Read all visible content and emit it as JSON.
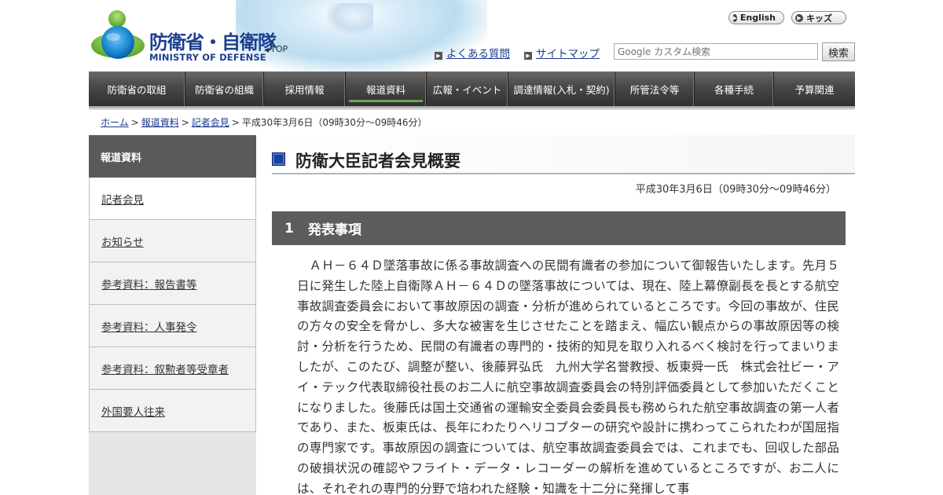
{
  "header": {
    "logo_jp": "防衛省・自衛隊",
    "logo_en": "MINISTRY OF DEFENSE",
    "top_link": "TOP",
    "english_label": "English",
    "kids_label": "キッズ",
    "faq_label": "よくある質問",
    "sitemap_label": "サイトマップ",
    "search_placeholder": "Google カスタム検索",
    "search_button": "検索"
  },
  "nav": {
    "items": [
      {
        "label": "防衛省の取組"
      },
      {
        "label": "防衛省の組織"
      },
      {
        "label": "採用情報"
      },
      {
        "label": "報道資料"
      },
      {
        "label": "広報・イベント"
      },
      {
        "label": "調達情報(入札・契約)"
      },
      {
        "label": "所管法令等"
      },
      {
        "label": "各種手続"
      },
      {
        "label": "予算関連"
      }
    ],
    "active_index": 3
  },
  "breadcrumb": {
    "home": "ホーム",
    "press": "報道資料",
    "conference": "記者会見",
    "sep": ">",
    "current": "平成30年3月6日（09時30分～09時46分）"
  },
  "sidebar": {
    "heading": "報道資料",
    "items": [
      {
        "label": "記者会見"
      },
      {
        "label": "お知らせ"
      },
      {
        "label": "参考資料：報告書等"
      },
      {
        "label": "参考資料：人事発令"
      },
      {
        "label": "参考資料：叙勲者等受章者"
      },
      {
        "label": "外国要人往来"
      }
    ]
  },
  "main": {
    "title": "防衛大臣記者会見概要",
    "date": "平成30年3月6日（09時30分～09時46分）",
    "section_number": "1",
    "section_title": "発表事項",
    "paragraph": "ＡＨ－６４Ｄ墜落事故に係る事故調査への民間有識者の参加について御報告いたします。先月５日に発生した陸上自衛隊ＡＨ－６４Ｄの墜落事故については、現在、陸上幕僚副長を長とする航空事故調査委員会において事故原因の調査・分析が進められているところです。今回の事故が、住民の方々の安全を脅かし、多大な被害を生じさせたことを踏まえ、幅広い観点からの事故原因等の検討・分析を行うため、民間の有識者の専門的・技術的知見を取り入れるべく検討を行ってまいりましたが、このたび、調整が整い、後藤昇弘氏　九州大学名誉教授、板東舜一氏　株式会社ビー・アイ・テック代表取締役社長のお二人に航空事故調査委員会の特別評価委員として参加いただくことになりました。後藤氏は国土交通省の運輸安全委員会委員長も務められた航空事故調査の第一人者であり、また、板東氏は、長年にわたりヘリコプターの研究や設計に携わってこられたわが国屈指の専門家です。事故原因の調査については、航空事故調査委員会では、これまでも、回収した部品の破損状況の確認やフライト・データ・レコーダーの解析を進めているところですが、お二人には、それぞれの専門的分野で培われた経験・知識を十二分に発揮して事"
  },
  "colors": {
    "brand_blue": "#1d3f8f",
    "nav_dark": "#3c3c3c",
    "nav_active_underline": "#6aa84f",
    "sidebar_head": "#5a5a5a",
    "section_bar": "#5c5c5c",
    "link": "#1a3a8a"
  },
  "icons": [
    "mod-logo-icon",
    "triangle-right-icon",
    "chevron-right-icon",
    "square-arrow-icon",
    "blue-square-icon"
  ]
}
